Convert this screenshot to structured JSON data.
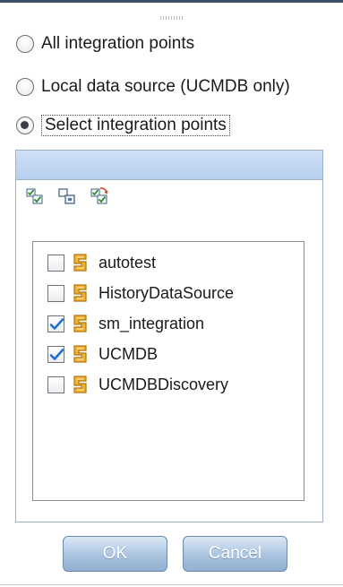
{
  "radio_options": [
    {
      "label": "All integration points",
      "selected": false
    },
    {
      "label": "Local data source (UCMDB only)",
      "selected": false
    },
    {
      "label": "Select integration points",
      "selected": true
    }
  ],
  "toolbar_icons": [
    "select-all-icon",
    "clear-selection-icon",
    "refresh-selection-icon"
  ],
  "integration_points": [
    {
      "label": "autotest",
      "checked": false
    },
    {
      "label": "HistoryDataSource",
      "checked": false
    },
    {
      "label": "sm_integration",
      "checked": true
    },
    {
      "label": "UCMDB",
      "checked": true
    },
    {
      "label": "UCMDBDiscovery",
      "checked": false
    }
  ],
  "buttons": {
    "ok": "OK",
    "cancel": "Cancel"
  },
  "colors": {
    "check": "#1f6fd1",
    "icon_orange": "#e9a21f",
    "header": "#c3d7f2"
  }
}
